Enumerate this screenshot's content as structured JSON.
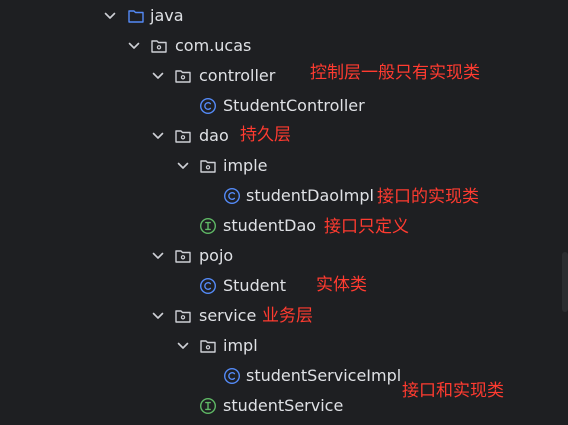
{
  "tree": {
    "java": "java",
    "com_ucas": "com.ucas",
    "controller": "controller",
    "student_controller": "StudentController",
    "dao": "dao",
    "imple": "imple",
    "student_dao_impl": "studentDaoImpl",
    "student_dao": "studentDao",
    "pojo": "pojo",
    "student": "Student",
    "service": "service",
    "impl": "impl",
    "student_service_impl": "studentServiceImpl",
    "student_service": "studentService"
  },
  "notes": {
    "controller": "控制层一般只有实现类",
    "dao": "持久层",
    "dao_impl": "接口的实现类",
    "dao_interface": "接口只定义",
    "pojo": "实体类",
    "service": "业务层",
    "service_impl": "接口和实现类"
  },
  "colors": {
    "background": "#1e1f22",
    "text": "#dfe1e5",
    "annotation": "#ff3b30",
    "class_icon": "#548af7",
    "interface_icon": "#5fb865",
    "folder_icon": "#ced0d6"
  },
  "icons": {
    "expanded": "chevron-down-icon",
    "folder": "folder-icon",
    "package": "package-icon",
    "class": "class-icon",
    "interface": "interface-icon"
  }
}
